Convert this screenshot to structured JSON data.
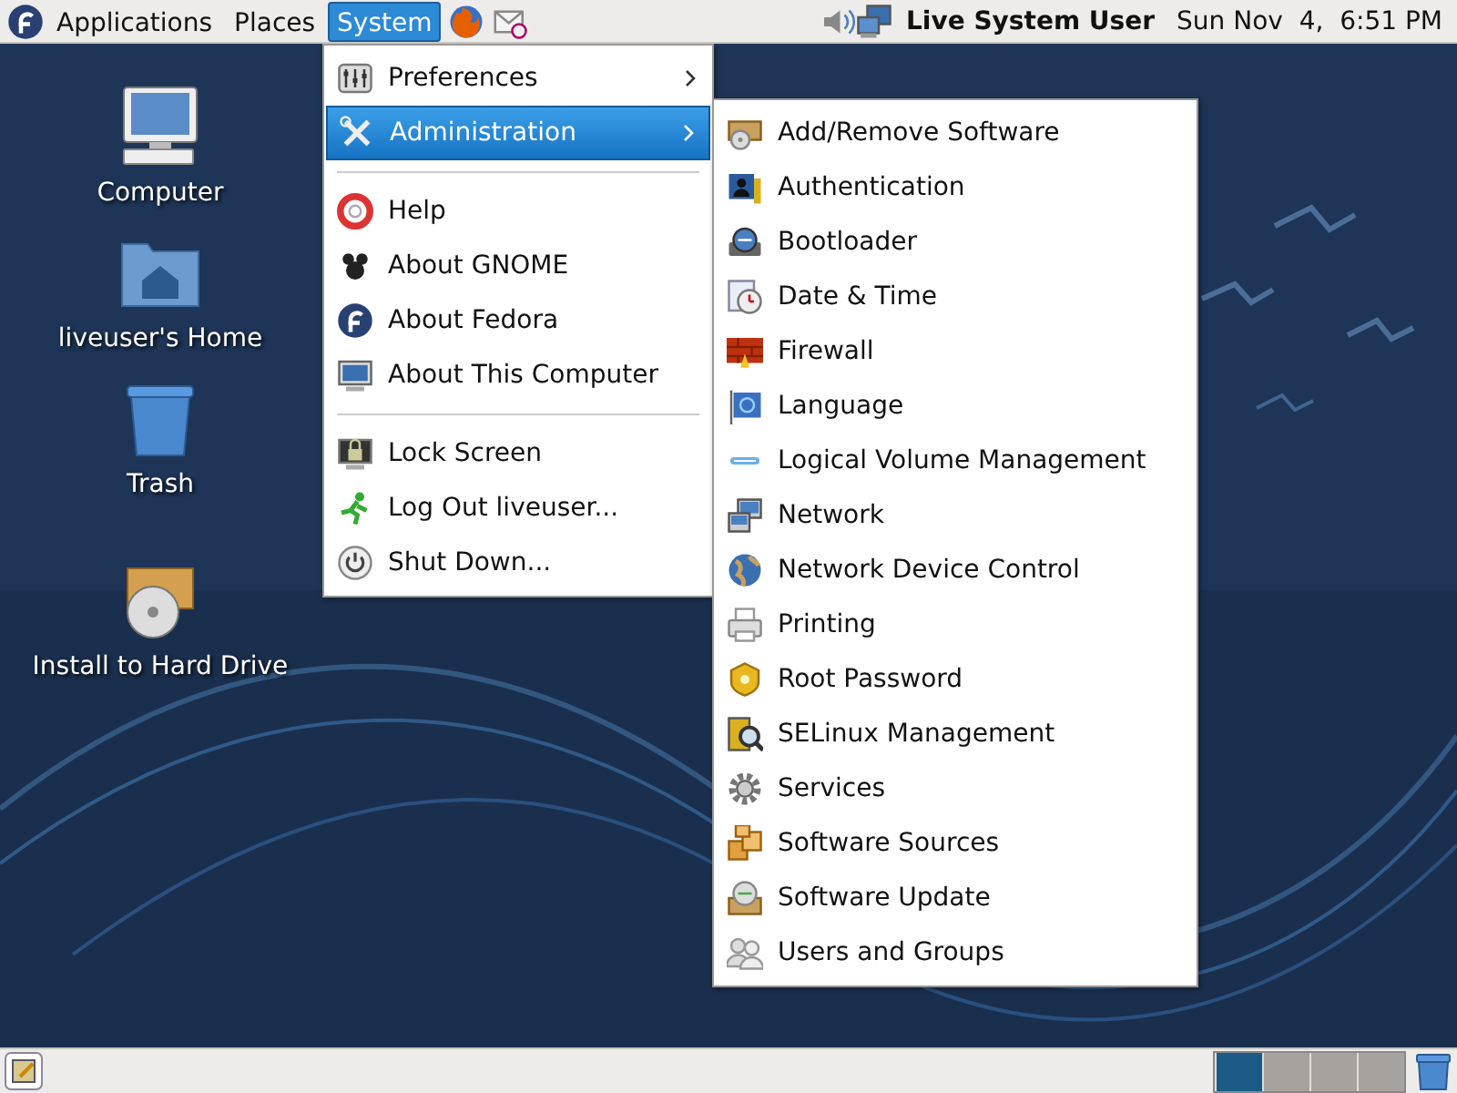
{
  "top_panel": {
    "menus": [
      {
        "label": "Applications",
        "selected": false
      },
      {
        "label": "Places",
        "selected": false
      },
      {
        "label": "System",
        "selected": true
      }
    ],
    "user": "Live System User",
    "clock": "Sun Nov  4,  6:51 PM"
  },
  "desktop_icons": [
    {
      "label": "Computer"
    },
    {
      "label": "liveuser's Home"
    },
    {
      "label": "Trash"
    },
    {
      "label": "Install to Hard Drive"
    }
  ],
  "system_menu": {
    "items": [
      {
        "kind": "item",
        "label": "Preferences",
        "submenu": true,
        "selected": false
      },
      {
        "kind": "item",
        "label": "Administration",
        "submenu": true,
        "selected": true
      },
      {
        "kind": "separator"
      },
      {
        "kind": "item",
        "label": "Help",
        "submenu": false,
        "selected": false
      },
      {
        "kind": "item",
        "label": "About GNOME",
        "submenu": false,
        "selected": false
      },
      {
        "kind": "item",
        "label": "About Fedora",
        "submenu": false,
        "selected": false
      },
      {
        "kind": "item",
        "label": "About This Computer",
        "submenu": false,
        "selected": false
      },
      {
        "kind": "separator"
      },
      {
        "kind": "item",
        "label": "Lock Screen",
        "submenu": false,
        "selected": false
      },
      {
        "kind": "item",
        "label": "Log Out liveuser...",
        "submenu": false,
        "selected": false
      },
      {
        "kind": "item",
        "label": "Shut Down...",
        "submenu": false,
        "selected": false
      }
    ]
  },
  "admin_menu": {
    "items": [
      {
        "kind": "item",
        "label": "Add/Remove Software",
        "submenu": false,
        "selected": false
      },
      {
        "kind": "item",
        "label": "Authentication",
        "submenu": false,
        "selected": false
      },
      {
        "kind": "item",
        "label": "Bootloader",
        "submenu": false,
        "selected": false
      },
      {
        "kind": "item",
        "label": "Date & Time",
        "submenu": false,
        "selected": false
      },
      {
        "kind": "item",
        "label": "Firewall",
        "submenu": false,
        "selected": false
      },
      {
        "kind": "item",
        "label": "Language",
        "submenu": false,
        "selected": false
      },
      {
        "kind": "item",
        "label": "Logical Volume Management",
        "submenu": false,
        "selected": false
      },
      {
        "kind": "item",
        "label": "Network",
        "submenu": false,
        "selected": false
      },
      {
        "kind": "item",
        "label": "Network Device Control",
        "submenu": false,
        "selected": false
      },
      {
        "kind": "item",
        "label": "Printing",
        "submenu": false,
        "selected": false
      },
      {
        "kind": "item",
        "label": "Root Password",
        "submenu": false,
        "selected": false
      },
      {
        "kind": "item",
        "label": "SELinux Management",
        "submenu": false,
        "selected": false
      },
      {
        "kind": "item",
        "label": "Services",
        "submenu": false,
        "selected": false
      },
      {
        "kind": "item",
        "label": "Software Sources",
        "submenu": false,
        "selected": false
      },
      {
        "kind": "item",
        "label": "Software Update",
        "submenu": false,
        "selected": false
      },
      {
        "kind": "item",
        "label": "Users and Groups",
        "submenu": false,
        "selected": false
      }
    ]
  },
  "bottom_panel": {
    "workspaces": [
      {
        "selected": true
      },
      {
        "selected": false
      },
      {
        "selected": false
      },
      {
        "selected": false
      }
    ]
  }
}
